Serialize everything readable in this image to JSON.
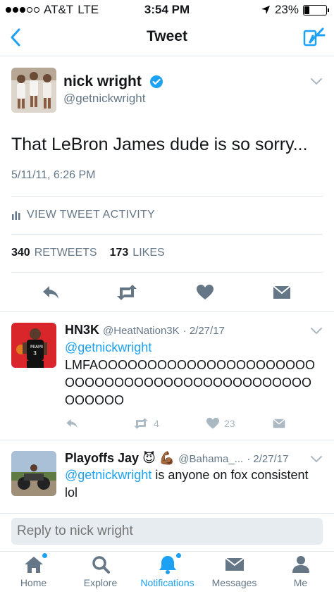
{
  "status_bar": {
    "carrier": "AT&T",
    "network": "LTE",
    "time": "3:54 PM",
    "battery": "23%"
  },
  "nav": {
    "title": "Tweet"
  },
  "tweet": {
    "author_name": "nick wright",
    "author_handle": "@getnickwright",
    "text": "That LeBron James dude is so sorry...",
    "date": "5/11/11, 6:26 PM",
    "activity_label": "VIEW TWEET ACTIVITY",
    "retweets_count": "340",
    "retweets_label": "RETWEETS",
    "likes_count": "173",
    "likes_label": "LIKES"
  },
  "replies": [
    {
      "name": "HN3K",
      "handle": "@HeatNation3K",
      "date": "· 2/27/17",
      "mention": "@getnickwright",
      "text": "LMFAOOOOOOOOOOOOOOOOOOOOOOOOOOOOOOOOOOOOOOOOOOOOOOOOOOOOO",
      "retweets": "4",
      "likes": "23"
    },
    {
      "name": "Playoffs Jay",
      "emoji": "😈 💪🏾",
      "handle": "@Bahama_...",
      "date": "· 2/27/17",
      "mention": "@getnickwright",
      "text": " is anyone on fox consistent lol"
    }
  ],
  "reply_bar": {
    "placeholder": "Reply to nick wright"
  },
  "tabs": [
    {
      "label": "Home",
      "icon": "home-icon"
    },
    {
      "label": "Explore",
      "icon": "search-icon"
    },
    {
      "label": "Notifications",
      "icon": "bell-icon"
    },
    {
      "label": "Messages",
      "icon": "envelope-icon"
    },
    {
      "label": "Me",
      "icon": "person-icon"
    }
  ],
  "colors": {
    "accent": "#1da1f2",
    "text": "#14171a",
    "muted": "#657786",
    "icon_gray": "#657786",
    "light_icon": "#aab8c2"
  }
}
